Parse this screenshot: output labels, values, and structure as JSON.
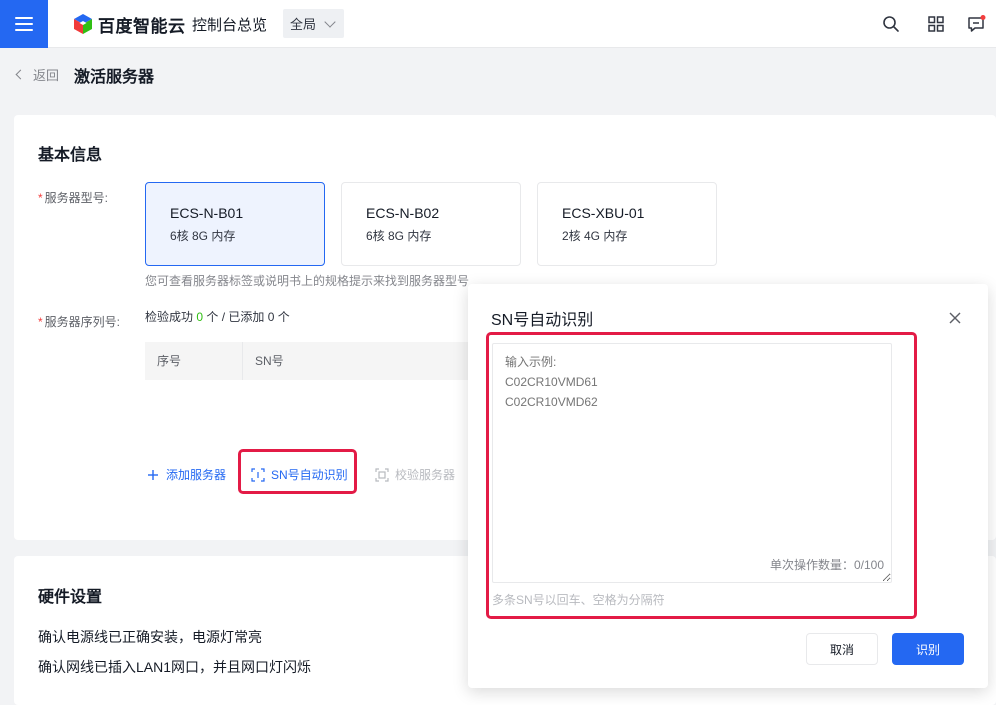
{
  "header": {
    "logo_text": "百度智能云",
    "console_title": "控制台总览",
    "scope": "全局",
    "icons": [
      "menu-icon",
      "search-icon",
      "app-grid-icon",
      "message-icon"
    ]
  },
  "breadcrumb": {
    "back_label": "返回",
    "page_title": "激活服务器"
  },
  "basic": {
    "title": "基本信息",
    "model_label": "服务器型号:",
    "models": [
      {
        "name": "ECS-N-B01",
        "desc": "6核 8G 内存",
        "selected": true
      },
      {
        "name": "ECS-N-B02",
        "desc": "6核 8G 内存",
        "selected": false
      },
      {
        "name": "ECS-XBU-01",
        "desc": "2核 4G 内存",
        "selected": false
      }
    ],
    "model_hint": "您可查看服务器标签或说明书上的规格提示来找到服务器型号",
    "sn_label": "服务器序列号:",
    "verify_prefix": "检验成功 ",
    "verify_ok": "0",
    "verify_suffix": " 个 / 已添加 0 个",
    "table_headers": [
      "序号",
      "SN号"
    ],
    "add_server": "添加服务器",
    "sn_recognize": "SN号自动识别",
    "verify_server": "校验服务器"
  },
  "hardware": {
    "title": "硬件设置",
    "lines": [
      "确认电源线已正确安装，电源灯常亮",
      "确认网线已插入LAN1网口，并且网口灯闪烁"
    ]
  },
  "dialog": {
    "title": "SN号自动识别",
    "placeholder": "输入示例:\nC02CR10VMD61\nC02CR10VMD62",
    "counter": "单次操作数量：0/100",
    "help": "多条SN号以回车、空格为分隔符",
    "cancel": "取消",
    "ok": "识别"
  },
  "colors": {
    "primary": "#2468f2",
    "highlight": "#e31b46",
    "success": "#30bf13"
  }
}
